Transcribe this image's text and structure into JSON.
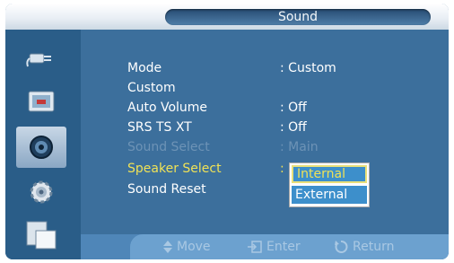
{
  "title": "Sound",
  "sidebar": {
    "items": [
      {
        "icon": "input-plug-icon",
        "active": false
      },
      {
        "icon": "picture-icon",
        "active": false
      },
      {
        "icon": "speaker-icon",
        "active": true
      },
      {
        "icon": "gear-icon",
        "active": false
      },
      {
        "icon": "multi-window-icon",
        "active": false
      }
    ]
  },
  "menu": {
    "rows": [
      {
        "label": "Mode",
        "value": ": Custom"
      },
      {
        "label": "Custom",
        "value": ""
      },
      {
        "label": "Auto Volume",
        "value": ": Off"
      },
      {
        "label": "SRS TS XT",
        "value": ": Off"
      },
      {
        "label": "Sound Select",
        "value": ": Main"
      },
      {
        "label": "Speaker Select",
        "value": ":"
      },
      {
        "label": "Sound Reset",
        "value": ""
      }
    ]
  },
  "dropdown": {
    "selected": "Internal",
    "other": "External"
  },
  "footer": {
    "move": "Move",
    "enter": "Enter",
    "return": "Return"
  },
  "colors": {
    "panel": "#3c6f9c",
    "sidebar": "#2a5d88",
    "highlight": "#f0e256",
    "disabled": "#6d93b6"
  }
}
